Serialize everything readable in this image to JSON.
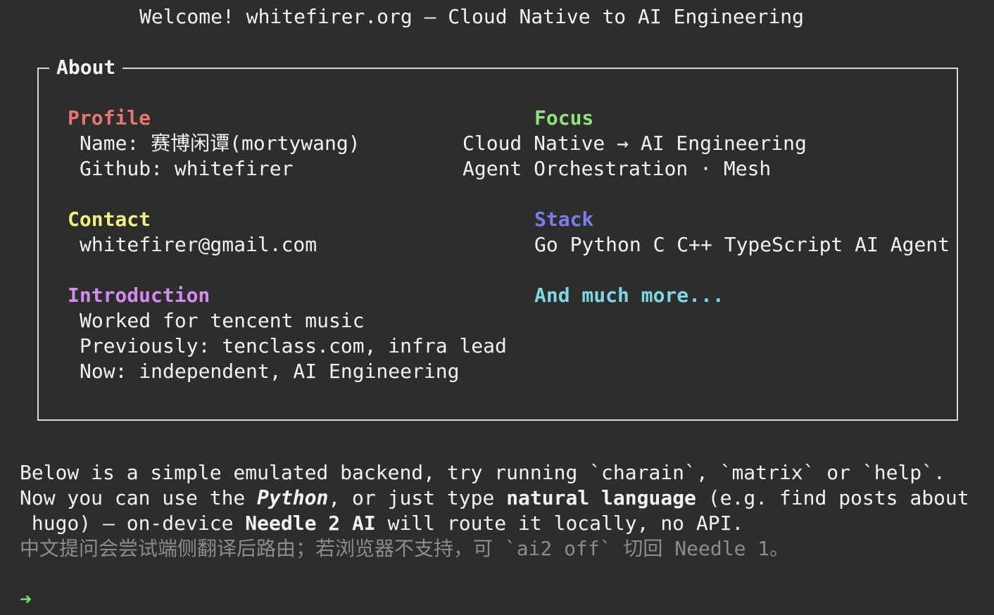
{
  "welcome": "Welcome! whitefirer.org — Cloud Native to AI Engineering",
  "about": {
    "title": "About",
    "profile": {
      "heading": "Profile",
      "name": "Name: 赛博闲谭(mortywang)",
      "github": "Github: whitefirer"
    },
    "focus": {
      "heading": "Focus",
      "line1": "Cloud Native → AI Engineering",
      "line2": "Agent Orchestration · Mesh"
    },
    "contact": {
      "heading": "Contact",
      "email": "whitefirer@gmail.com"
    },
    "stack": {
      "heading": "Stack",
      "items": "Go Python C C++ TypeScript AI Agent"
    },
    "introduction": {
      "heading": "Introduction",
      "line1": "Worked for tencent music",
      "line2": "Previously: tenclass.com, infra lead",
      "line3": "Now: independent, AI Engineering"
    },
    "more": "And much more..."
  },
  "info": {
    "line1": "Below is a simple emulated backend, try running `charain`, `matrix` or `help`.",
    "line2_a": "Now you can use the ",
    "line2_python": "Python",
    "line2_b": ", or just type ",
    "line2_nl": "natural language",
    "line2_c": " (e.g. find posts about",
    "line3_a": " hugo) — on-device ",
    "line3_needle": "Needle 2 AI",
    "line3_b": " will route it locally, no API.",
    "line4": "中文提问会尝试端侧翻译后路由；若浏览器不支持，可 `ai2 off` 切回 Needle 1。"
  },
  "prompt_symbol": "➜",
  "colors": {
    "background": "#2d2d2b",
    "profile": "#e87474",
    "focus": "#8fe37e",
    "contact": "#f4ef82",
    "stack": "#7b7cf0",
    "introduction": "#d48af0",
    "more": "#7fd6e6",
    "prompt": "#6fe36c"
  }
}
